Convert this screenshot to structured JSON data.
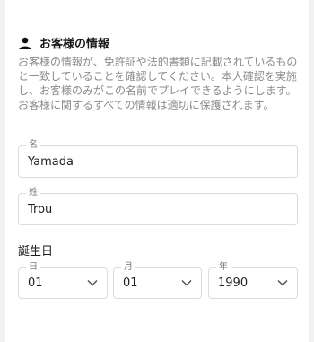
{
  "section": {
    "title": "お客様の情報",
    "icon": "person-icon",
    "description": "お客様の情報が、免許証や法的書類に記載されているものと一致していることを確認してください。本人確認を実施し、お客様のみがこの名前でプレイできるようにします。お客様に関するすべての情報は適切に保護されます。"
  },
  "first_name": {
    "label": "名",
    "value": "Yamada"
  },
  "last_name": {
    "label": "姓",
    "value": "Trou"
  },
  "birthdate": {
    "heading": "誕生日",
    "day": {
      "label": "日",
      "value": "01"
    },
    "month": {
      "label": "月",
      "value": "01"
    },
    "year": {
      "label": "年",
      "value": "1990"
    }
  }
}
